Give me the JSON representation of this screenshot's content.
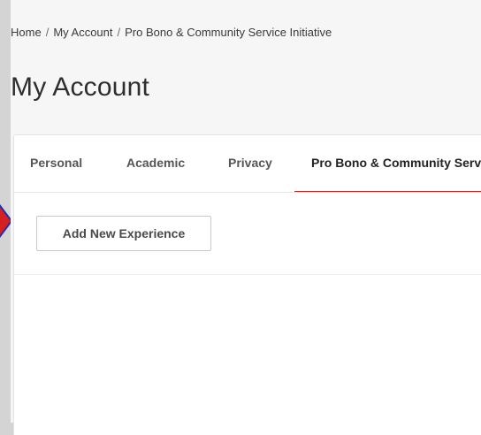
{
  "breadcrumb": {
    "items": [
      "Home",
      "My Account",
      "Pro Bono & Community Service Initiative"
    ],
    "separator": "/"
  },
  "header": {
    "title": "My Account"
  },
  "tabs": [
    {
      "label": "Personal",
      "active": false
    },
    {
      "label": "Academic",
      "active": false
    },
    {
      "label": "Privacy",
      "active": false
    },
    {
      "label": "Pro Bono & Community Service",
      "active": true
    }
  ],
  "main": {
    "add_button_label": "Add New Experience"
  },
  "colors": {
    "accent": "#cc1f1f",
    "pointer_fill": "#d42020",
    "pointer_stroke": "#1f2fb0"
  }
}
